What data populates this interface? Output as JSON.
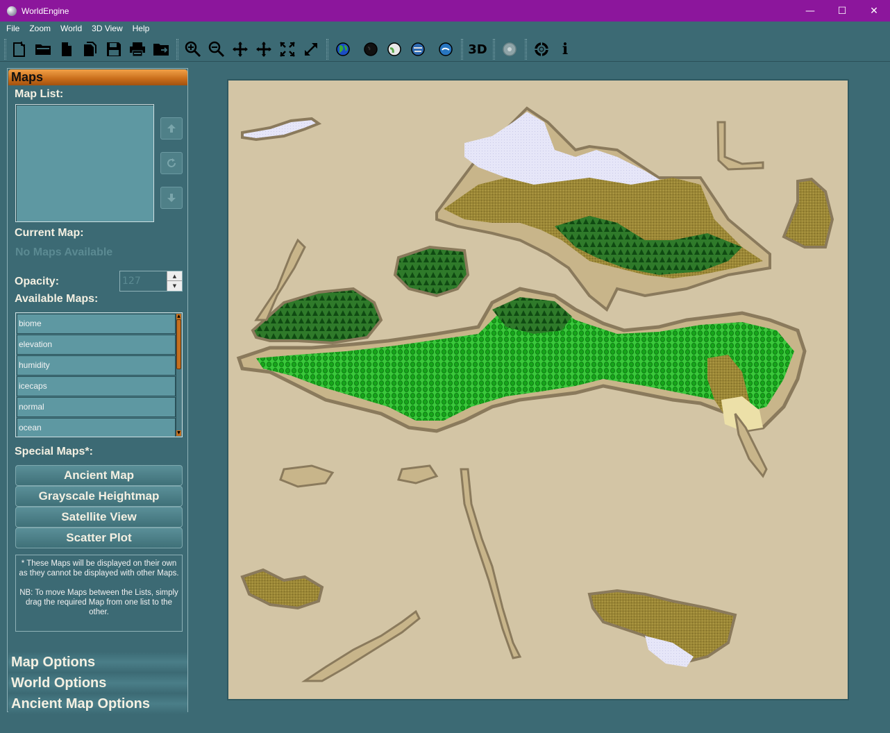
{
  "window": {
    "title": "WorldEngine",
    "controls": {
      "minimize": "—",
      "maximize": "☐",
      "close": "✕"
    }
  },
  "menu": [
    "File",
    "Zoom",
    "World",
    "3D View",
    "Help"
  ],
  "toolbar": {
    "label_3d": "3D",
    "info_glyph": "i",
    "icons": [
      "new-file-icon",
      "open-icon",
      "document-icon",
      "copy-icon",
      "save-icon",
      "print-icon",
      "export-icon",
      "zoom-in-icon",
      "zoom-out-icon",
      "move-icon",
      "move-icon",
      "fit-icon",
      "expand-icon",
      "globe-color-icon",
      "globe-dark-icon",
      "globe-light-icon",
      "globe-blue-icon",
      "globe-ocean-icon",
      "3d-view-icon",
      "settings-disabled-icon",
      "help-lifebuoy-icon",
      "info-icon"
    ]
  },
  "panel": {
    "header": "Maps",
    "map_list_label": "Map List:",
    "current_map_label": "Current Map:",
    "current_map_value": "No Maps Available",
    "opacity_label": "Opacity:",
    "opacity_value": "127",
    "available_label": "Available Maps:",
    "available_maps": [
      "biome",
      "elevation",
      "humidity",
      "icecaps",
      "normal",
      "ocean"
    ],
    "special_label": "Special Maps*:",
    "special_maps": [
      "Ancient Map",
      "Grayscale Heightmap",
      "Satellite View",
      "Scatter Plot"
    ],
    "note_line1": "* These Maps will be displayed on their own as they cannot be displayed with other Maps.",
    "note_line2": "NB: To move Maps between the Lists, simply drag the required Map from one list to the other.",
    "sections": [
      "Map Options",
      "World Options",
      "Ancient Map Options"
    ]
  },
  "colors": {
    "titlebar": "#8c169c",
    "background": "#3c6a74",
    "parchment": "#d3c5a5",
    "land_edge": "#8a7a5c",
    "sand": "#c8b58a",
    "forest": "#1e6a1e",
    "jungle": "#33cc33",
    "steppe": "#9a8634",
    "ice": "#e4e4f7"
  }
}
